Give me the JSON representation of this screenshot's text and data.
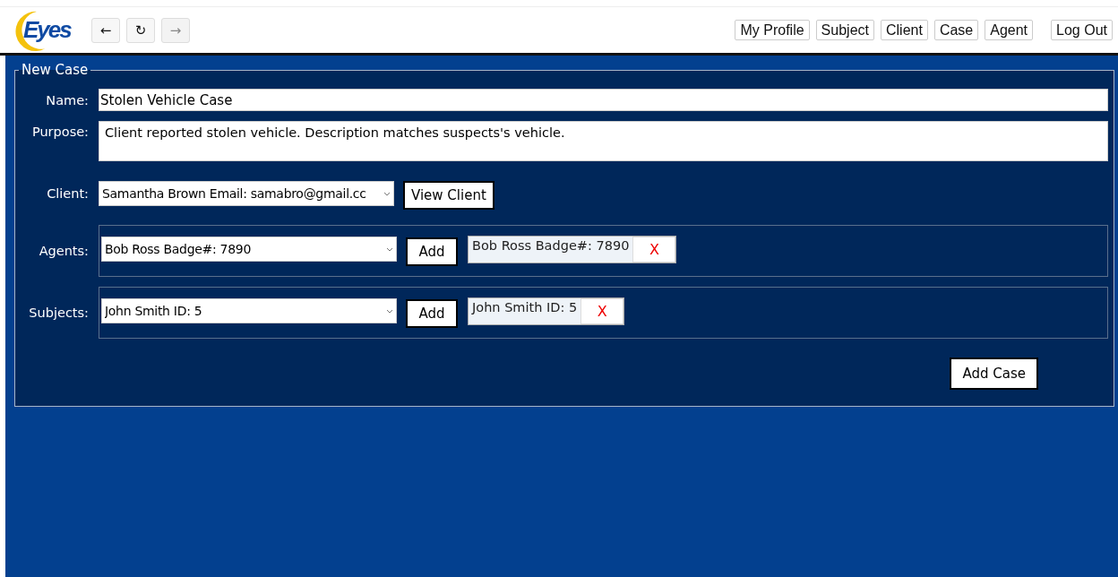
{
  "header": {
    "logo": "Eyes",
    "history": [
      {
        "label": "←",
        "disabled": false
      },
      {
        "label": "↻",
        "disabled": false
      },
      {
        "label": "→",
        "disabled": true
      }
    ],
    "nav": [
      "My Profile",
      "Subject",
      "Client",
      "Case",
      "Agent"
    ],
    "logout": "Log Out"
  },
  "form": {
    "legend": "New Case",
    "name": {
      "label": "Name:",
      "value": "Stolen Vehicle Case"
    },
    "purpose": {
      "label": "Purpose:",
      "value": "Client reported stolen vehicle. Description matches suspects's vehicle."
    },
    "client": {
      "label": "Client:",
      "value": "Samantha Brown Email: samabro@gmail.cc",
      "button": "View Client"
    },
    "lists": [
      {
        "label": "Agents:",
        "value": "Bob Ross Badge#: 7890",
        "button": "Add",
        "items": [
          {
            "text": "Bob Ross Badge#: 7890",
            "remove": "X"
          }
        ]
      },
      {
        "label": "Subjects:",
        "value": "John Smith ID: 5",
        "button": "Add",
        "items": [
          {
            "text": "John Smith ID: 5",
            "remove": "X"
          }
        ]
      }
    ],
    "submit": "Add Case"
  }
}
